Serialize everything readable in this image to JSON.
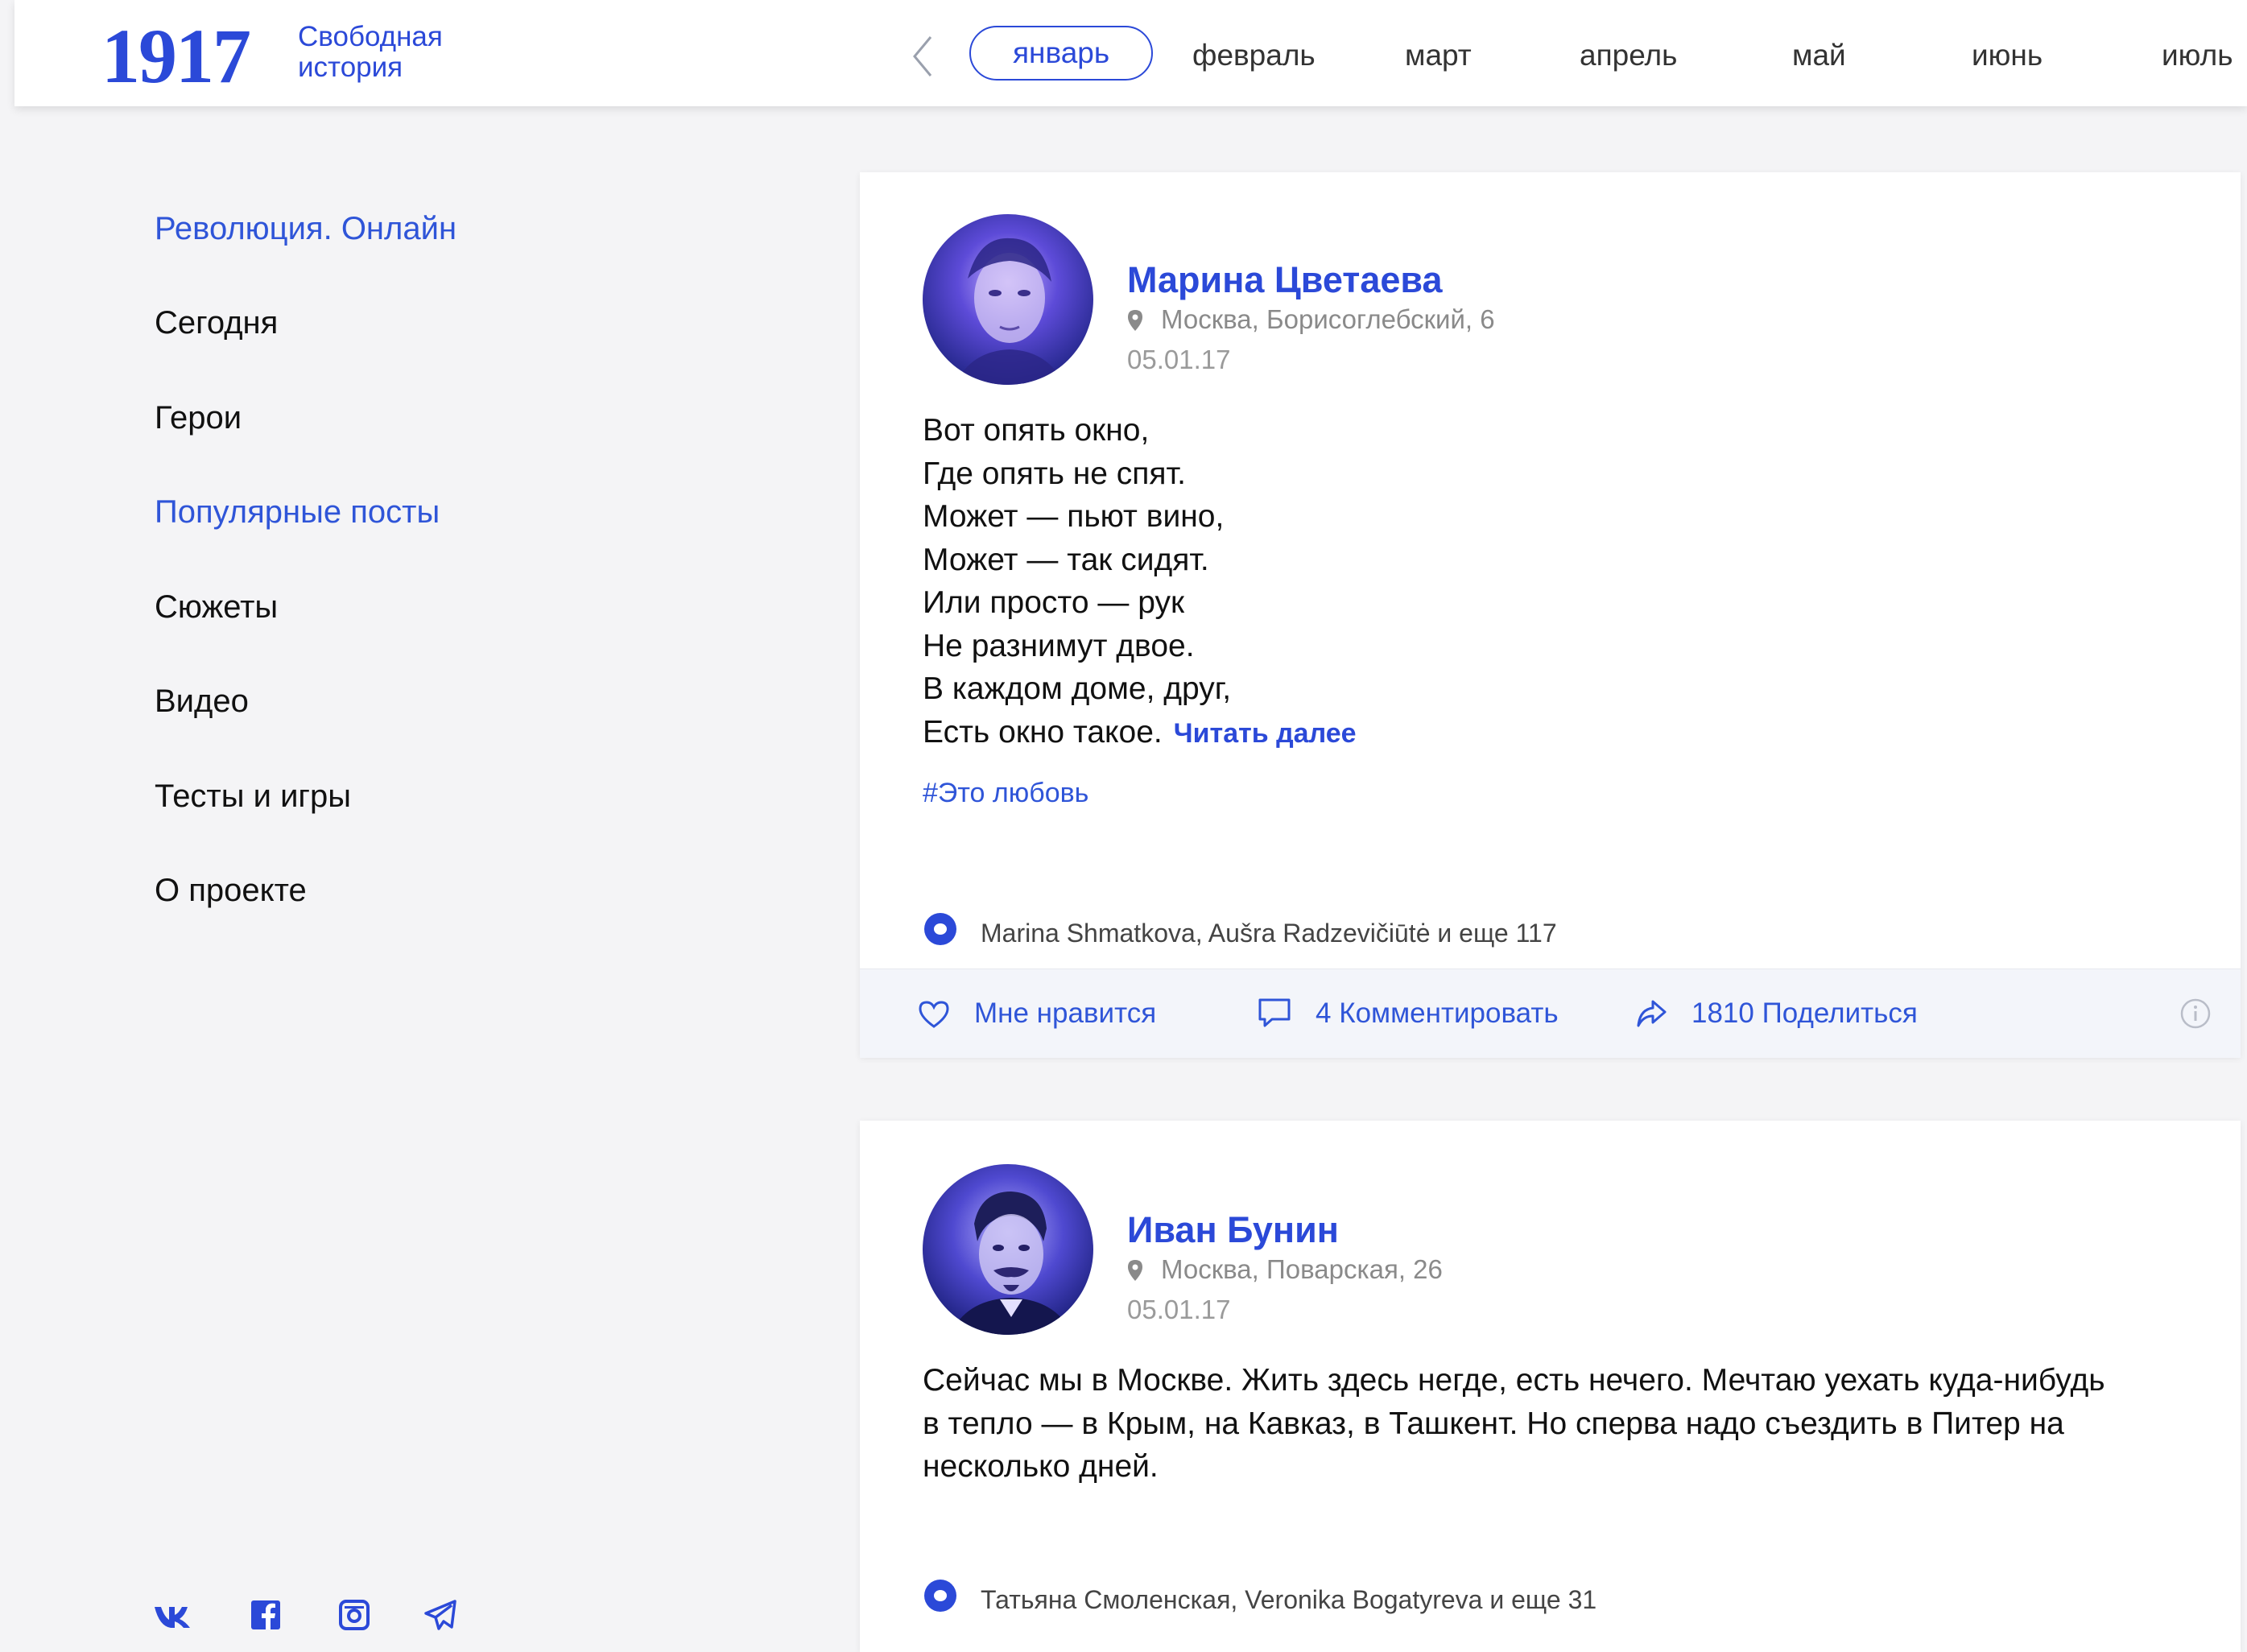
{
  "brand": {
    "number": "1917",
    "line1": "Свободная",
    "line2": "история"
  },
  "months": [
    "январь",
    "февраль",
    "март",
    "апрель",
    "май",
    "июнь",
    "июль"
  ],
  "active_month": "январь",
  "nav": [
    "Революция. Онлайн",
    "Сегодня",
    "Герои",
    "Популярные посты",
    "Сюжеты",
    "Видео",
    "Тесты и игры",
    "О проекте"
  ],
  "social": [
    "vk-icon",
    "facebook-icon",
    "instagram-icon",
    "telegram-icon"
  ],
  "colors": {
    "accent": "#2b49d8",
    "link": "#2f55d8",
    "background": "#f4f4f6"
  },
  "posts": [
    {
      "author": "Марина Цветаева",
      "location": "Москва, Борисоглебский, 6",
      "date": "05.01.17",
      "lines": [
        "Вот опять окно,",
        "Где опять не спят.",
        "Может — пьют вино,",
        "Может — так сидят.",
        "Или просто — рук",
        "Не разнимут двое.",
        "В каждом доме, друг,",
        "Есть окно такое."
      ],
      "read_more": "Читать далее",
      "hashtag": "#Это любовь",
      "likers": "Marina Shmatkova, Aušra Radzevičiūtė и еще 117",
      "like_label": "Мне нравится",
      "comment_label": "4 Комментировать",
      "share_label": "1810 Поделиться"
    },
    {
      "author": "Иван Бунин",
      "location": "Москва, Поварская, 26",
      "date": "05.01.17",
      "lines": [
        "Сейчас мы в Москве. Жить здесь негде, есть нечего. Мечтаю уехать куда-нибудь",
        "в тепло — в Крым, на Кавказ, в Ташкент. Но сперва надо съездить в Питер на",
        "несколько дней."
      ],
      "likers": "Татьяна Смоленская, Veronika Bogatyreva и еще 31"
    }
  ]
}
